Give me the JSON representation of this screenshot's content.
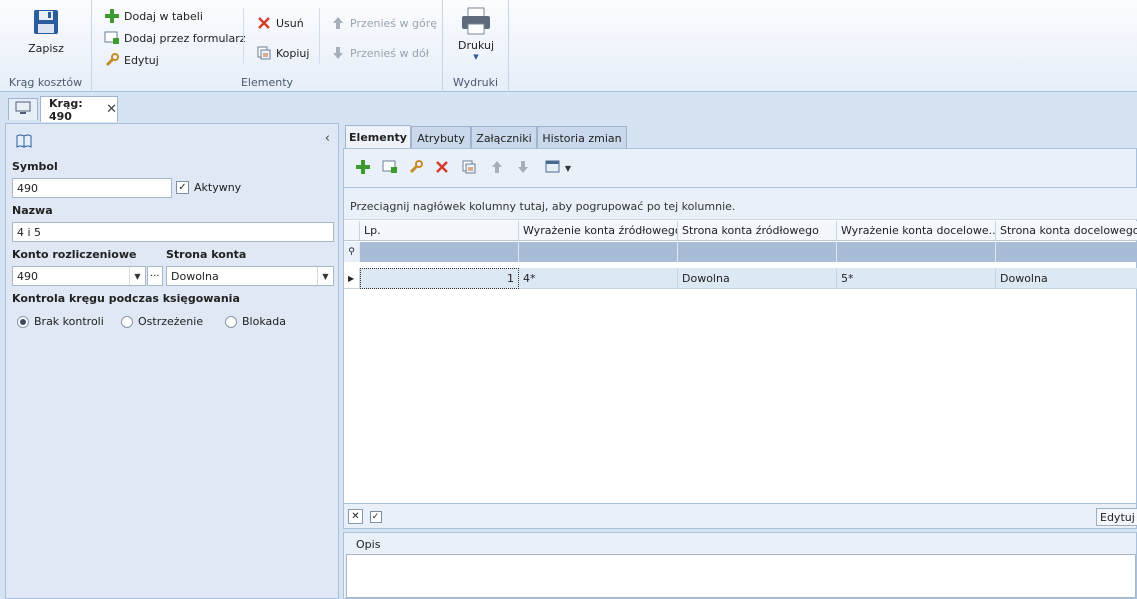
{
  "ribbon": {
    "groups": {
      "krag": {
        "label": "Krąg kosztów",
        "save": "Zapisz"
      },
      "elementy": {
        "label": "Elementy",
        "add_table": "Dodaj w tabeli",
        "add_form": "Dodaj przez formularz",
        "edit": "Edytuj",
        "delete": "Usuń",
        "copy": "Kopiuj",
        "move_up": "Przenieś w górę",
        "move_down": "Przenieś w dół"
      },
      "wydruki": {
        "label": "Wydruki",
        "print": "Drukuj"
      }
    }
  },
  "doc_tab": {
    "title": "Krąg: 490"
  },
  "form": {
    "symbol_label": "Symbol",
    "symbol_value": "490",
    "active_label": "Aktywny",
    "active_checked": true,
    "name_label": "Nazwa",
    "name_value": "4 i 5",
    "account_label": "Konto rozliczeniowe",
    "account_value": "490",
    "side_label": "Strona konta",
    "side_value": "Dowolna",
    "control_label": "Kontrola kręgu podczas księgowania",
    "radios": [
      "Brak kontroli",
      "Ostrzeżenie",
      "Blokada"
    ],
    "radio_selected": "Brak kontroli"
  },
  "content_tabs": [
    "Elementy",
    "Atrybuty",
    "Załączniki",
    "Historia zmian"
  ],
  "grid": {
    "group_hint": "Przeciągnij nagłówek kolumny tutaj, aby pogrupować po tej kolumnie.",
    "columns": [
      "Lp.",
      "Wyrażenie konta źródłowego",
      "Strona konta źródłowego",
      "Wyrażenie konta docelowe...",
      "Strona konta docelowego"
    ],
    "rows": [
      [
        "1",
        "4*",
        "Dowolna",
        "5*",
        "Dowolna"
      ]
    ],
    "footer_edit": "Edytuj f"
  },
  "opis": {
    "label": "Opis",
    "value": ""
  }
}
